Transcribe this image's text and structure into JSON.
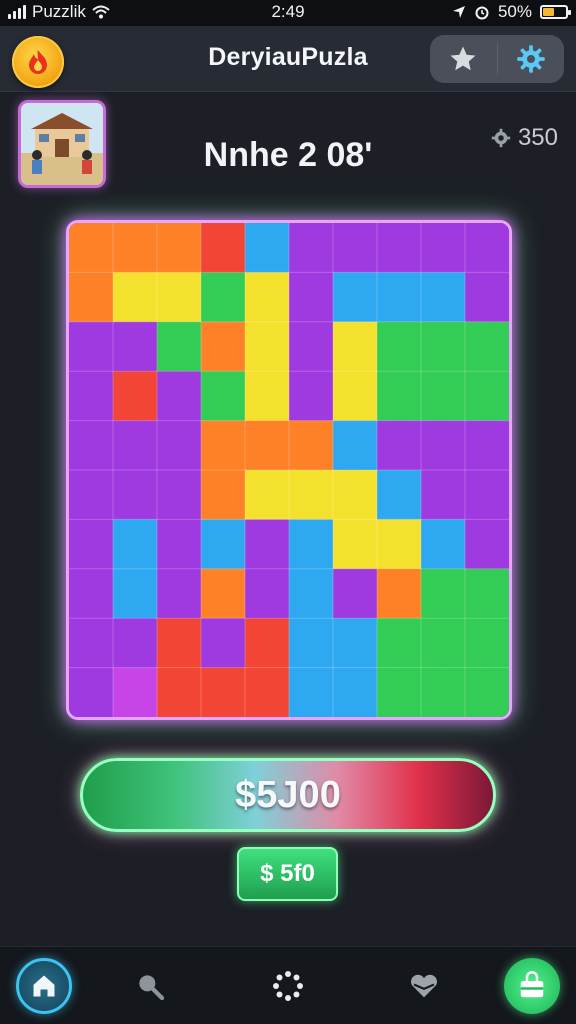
{
  "status_bar": {
    "carrier": "Puzzlik",
    "time": "2:49",
    "battery": "50%",
    "battery_level": 0.5,
    "icons": [
      "signal-icon",
      "wifi-icon",
      "location-icon",
      "alarm-icon",
      "battery-icon"
    ]
  },
  "header": {
    "title": "DeryiauPuzla",
    "logo_icon": "flame-icon",
    "actions": [
      {
        "name": "favorite",
        "icon": "star-icon"
      },
      {
        "name": "settings",
        "icon": "gear-icon"
      }
    ]
  },
  "level": {
    "title": "Nnhe 2 08'",
    "thumbnail": "house-picture",
    "coins": "350",
    "coin_icon": "gear-coin-icon"
  },
  "board": {
    "rows": 10,
    "cols": 10,
    "colors": {
      "orange": "#ff7a1a",
      "yellow": "#f4e020",
      "green": "#27c94b",
      "blue": "#22a3f2",
      "purple": "#9a2ee0",
      "red": "#f23a2a",
      "magenta": "#c43ae6"
    },
    "pattern": [
      [
        "orange",
        "orange",
        "orange",
        "red",
        "blue",
        "purple",
        "purple",
        "purple",
        "purple",
        "purple"
      ],
      [
        "orange",
        "yellow",
        "yellow",
        "green",
        "yellow",
        "purple",
        "blue",
        "blue",
        "blue",
        "purple"
      ],
      [
        "purple",
        "purple",
        "green",
        "orange",
        "yellow",
        "purple",
        "yellow",
        "green",
        "green",
        "green"
      ],
      [
        "purple",
        "red",
        "purple",
        "green",
        "yellow",
        "purple",
        "yellow",
        "green",
        "green",
        "green"
      ],
      [
        "purple",
        "purple",
        "purple",
        "orange",
        "orange",
        "orange",
        "blue",
        "purple",
        "purple",
        "purple"
      ],
      [
        "purple",
        "purple",
        "purple",
        "orange",
        "yellow",
        "yellow",
        "yellow",
        "blue",
        "purple",
        "purple"
      ],
      [
        "purple",
        "blue",
        "purple",
        "blue",
        "purple",
        "blue",
        "yellow",
        "yellow",
        "blue",
        "purple"
      ],
      [
        "purple",
        "blue",
        "purple",
        "orange",
        "purple",
        "blue",
        "purple",
        "orange",
        "green",
        "green"
      ],
      [
        "purple",
        "purple",
        "red",
        "purple",
        "red",
        "blue",
        "blue",
        "green",
        "green",
        "green"
      ],
      [
        "purple",
        "magenta",
        "red",
        "red",
        "red",
        "blue",
        "blue",
        "green",
        "green",
        "green"
      ]
    ]
  },
  "price_button": {
    "label": "$5J00"
  },
  "small_button": {
    "label": "$ 5f0"
  },
  "bottom_nav": [
    {
      "name": "home",
      "icon": "home-icon"
    },
    {
      "name": "search",
      "icon": "search-icon"
    },
    {
      "name": "loading",
      "icon": "loading-icon"
    },
    {
      "name": "likes",
      "icon": "heart-icon"
    },
    {
      "name": "shop",
      "icon": "bag-icon"
    }
  ]
}
